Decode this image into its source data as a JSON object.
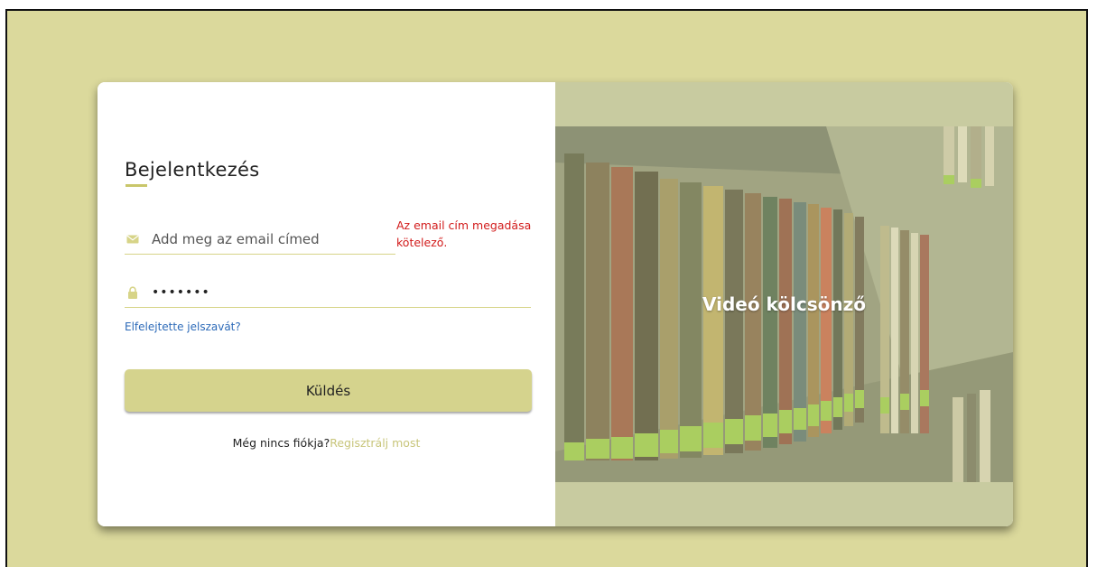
{
  "login": {
    "title": "Bejelentkezés",
    "email_placeholder": "Add meg az email címed",
    "email_value": "",
    "email_error": "Az email cím megadása kötelező.",
    "password_value": "•••••••",
    "forgot_link": "Elfelejtette jelszavát?",
    "submit_label": "Küldés",
    "no_account_text": "Még nincs fiókja?",
    "register_link": "Regisztrálj most"
  },
  "hero": {
    "caption": "Videó kölcsönző"
  },
  "icons": {
    "email": "envelope-icon",
    "password": "lock-icon"
  },
  "colors": {
    "background": "#dbd99c",
    "accent": "#d5d38d",
    "error": "#d21b1b",
    "link": "#2c6ab8",
    "register_link": "#c8c57a"
  }
}
